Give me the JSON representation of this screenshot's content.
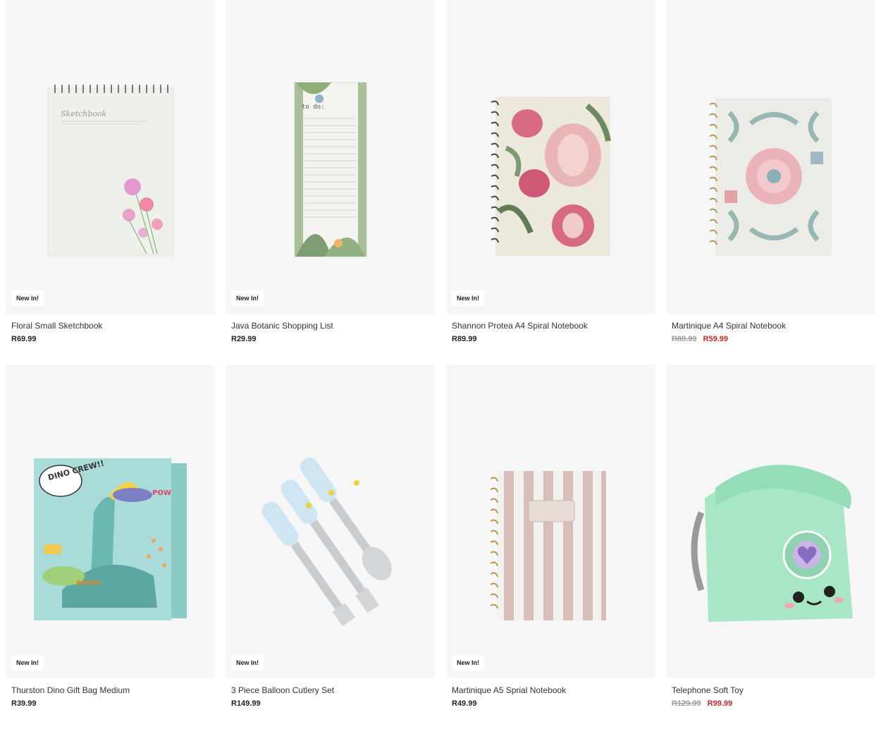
{
  "colors": {
    "card_background": "#f6f6f6",
    "sale_price": "#c62828",
    "old_price": "#999999",
    "text": "#222222"
  },
  "products": [
    {
      "title": "Floral Small Sketchbook",
      "price": "R69.99",
      "badge": "New In!",
      "image": "sketchbook-image"
    },
    {
      "title": "Java Botanic Shopping List",
      "price": "R29.99",
      "badge": "New In!",
      "image": "shopping-list-image"
    },
    {
      "title": "Shannon Protea A4 Spiral Notebook",
      "price": "R89.99",
      "badge": "New In!",
      "image": "protea-notebook-image"
    },
    {
      "title": "Martinique A4 Spiral Notebook",
      "old_price": "R89.99",
      "sale_price": "R59.99",
      "image": "martinique-notebook-image"
    },
    {
      "title": "Thurston Dino Gift Bag Medium",
      "price": "R39.99",
      "badge": "New In!",
      "image": "dino-gift-bag-image"
    },
    {
      "title": "3 Piece Balloon Cutlery Set",
      "price": "R149.99",
      "badge": "New In!",
      "image": "cutlery-set-image"
    },
    {
      "title": "Martinique A5 Sprial Notebook",
      "price": "R49.99",
      "badge": "New In!",
      "image": "striped-notebook-image"
    },
    {
      "title": "Telephone Soft Toy",
      "old_price": "R129.99",
      "sale_price": "R99.99",
      "image": "telephone-toy-image"
    }
  ],
  "image_text": {
    "sketchbook_cover": "Sketchbook",
    "shopping_list_header": "to do:",
    "dino_bag_speech": "DINO CREW!!",
    "dino_bag_pow": "POW",
    "dino_bag_boom": "BOOM"
  }
}
